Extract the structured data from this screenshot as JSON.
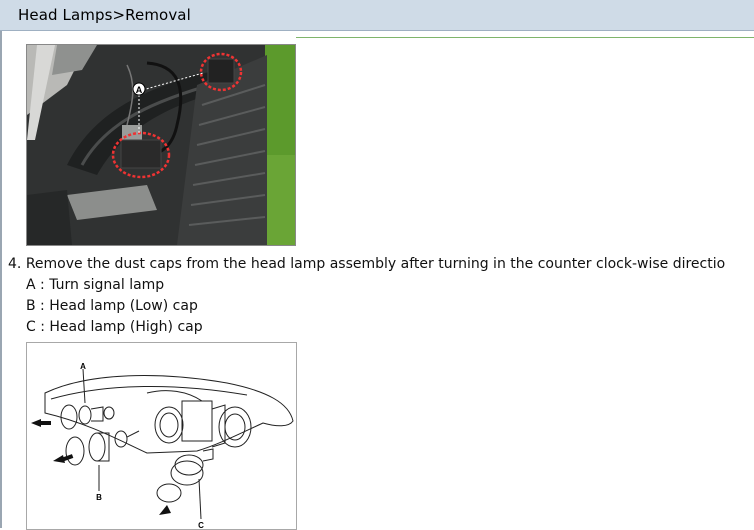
{
  "header": {
    "title": "Head Lamps>Removal"
  },
  "photo": {
    "callout_label": "A"
  },
  "step": {
    "number": "4.",
    "text": "Remove the dust caps from the head lamp assembly after turning in the counter clock-wise directio"
  },
  "items": [
    {
      "text": "A : Turn signal lamp"
    },
    {
      "text": "B : Head lamp (Low) cap"
    },
    {
      "text": "C : Head lamp (High) cap"
    }
  ],
  "diagram": {
    "labels": {
      "a": "A",
      "b": "B",
      "c": "C"
    }
  }
}
